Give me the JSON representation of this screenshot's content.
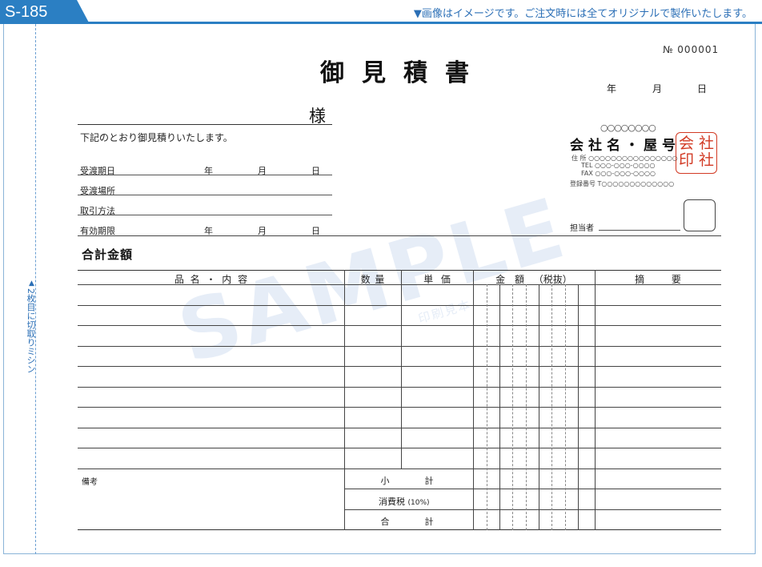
{
  "header": {
    "product_code": "S-185",
    "notice": "▼画像はイメージです。ご注文時には全てオリジナルで製作いたします。"
  },
  "perforation": {
    "arrow": "▲",
    "label": "2枚目に切取りミシン"
  },
  "watermark": {
    "text": "SAMPLE",
    "sub": "印刷見本"
  },
  "document": {
    "title": "御見積書",
    "number": "№ 000001",
    "date_units": [
      "年",
      "月",
      "日"
    ]
  },
  "recipient": {
    "honorific": "様",
    "intro": "下記のとおり御見積りいたします。",
    "fields": [
      {
        "label": "受渡期日",
        "has_date": true
      },
      {
        "label": "受渡場所",
        "has_date": false
      },
      {
        "label": "取引方法",
        "has_date": false
      },
      {
        "label": "有効期限",
        "has_date": true
      }
    ],
    "date_units": [
      "年",
      "月",
      "日"
    ]
  },
  "company": {
    "placeholder_top": "○○○○○○○○",
    "name": "会社名・屋号",
    "address": "住 所 ○○○○○○○○○○○○○○○○",
    "tel": "TEL ○○○-○○○-○○○○",
    "fax": "FAX ○○○-○○○-○○○○",
    "registration": "登録番号 T○○○○○○○○○○○○○",
    "seal": [
      "会",
      "社",
      "印",
      "社"
    ],
    "seal_color": "#d23a24",
    "person_in_charge": "担当者"
  },
  "total": {
    "label": "合計金額"
  },
  "table": {
    "headers": {
      "item": "品 名 ・ 内 容",
      "quantity": "数 量",
      "unit_price": "単 価",
      "amount": "金 額 （税抜）",
      "remarks": "摘 要"
    },
    "body_rows": 9,
    "notes_label": "備考",
    "subtotal_label": "小　　　　計",
    "tax_label": "消費税",
    "tax_rate": "(10%)",
    "grand_total_label": "合　　　　計"
  },
  "colors": {
    "accent": "#2b7fc3",
    "rule": "#444444",
    "watermark": "#e6edf7"
  }
}
